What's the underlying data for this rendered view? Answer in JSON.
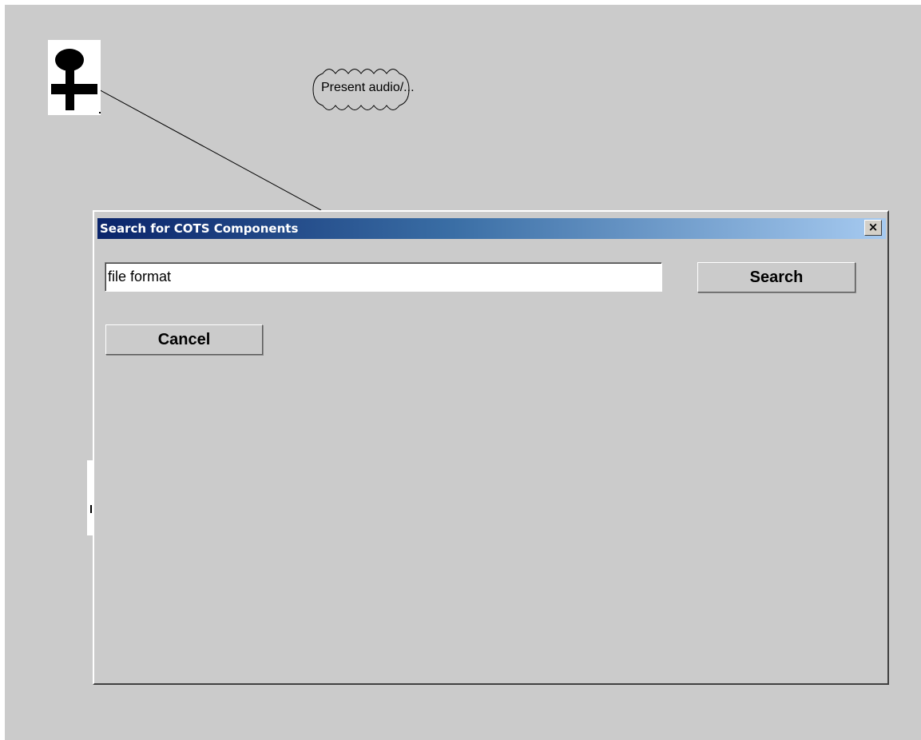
{
  "diagram": {
    "actor_icon": "actor-stick-figure-icon",
    "use_case_label": "Present audio/..."
  },
  "dialog": {
    "title": "Search for COTS Components",
    "close_label": "×",
    "search_field": {
      "value": "file format",
      "placeholder": ""
    },
    "search_button_label": "Search",
    "cancel_button_label": "Cancel"
  },
  "colors": {
    "desktop": "#cbcbcb",
    "titlebar_start": "#0a246a",
    "titlebar_end": "#a6caf0"
  }
}
